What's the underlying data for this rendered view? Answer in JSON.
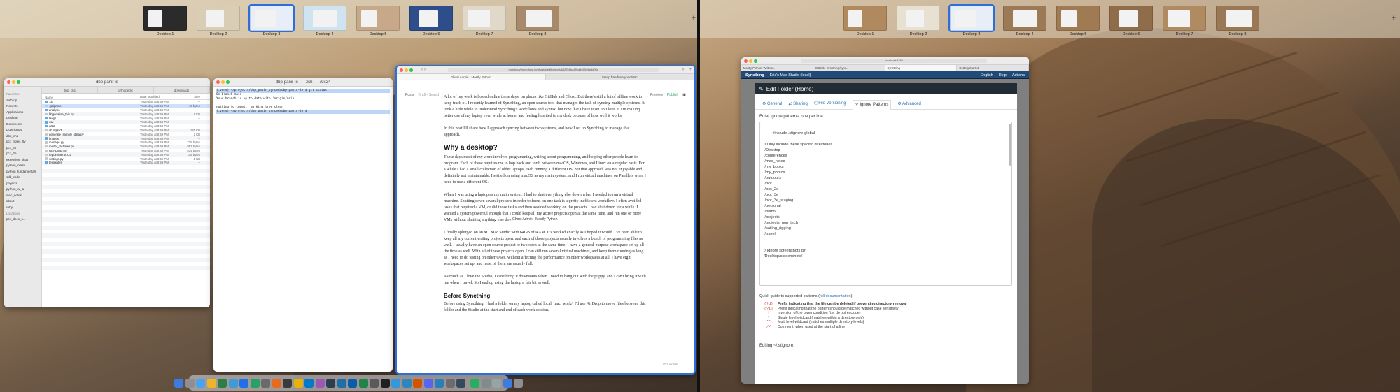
{
  "desktops_left": [
    "Desktop 1",
    "Desktop 2",
    "Desktop 3",
    "Desktop 4",
    "Desktop 5",
    "Desktop 6",
    "Desktop 7",
    "Desktop 8"
  ],
  "desktops_right": [
    "Desktop 1",
    "Desktop 2",
    "Desktop 3",
    "Desktop 4",
    "Desktop 5",
    "Desktop 6",
    "Desktop 7",
    "Desktop 8"
  ],
  "colors": {
    "accent": "#2c6fdc",
    "syncthing_nav": "#204b78",
    "published": "#29a35a"
  },
  "finder": {
    "title": "dbp-panir-ie",
    "sidebar_favorites": "Favorites",
    "sidebar": [
      "AirDrop",
      "Recents",
      "Applications",
      "Desktop",
      "Documents",
      "Downloads",
      "dbp_ch1",
      "pcc_notes_ltv",
      "pcc_sp",
      "pcc_2e",
      "extension_pkgs",
      "python_crash",
      "python_fundamentals",
      "sdd_code",
      "projects",
      "python_w_ia",
      "mac_notes",
      "about",
      "retry"
    ],
    "sidebar_locations": "Locations",
    "sidebar_locations_item": "pcc_docs_s...",
    "tabs": [
      "dbp_ch1",
      "orthopedic",
      "downloads"
    ],
    "headers": [
      "Name",
      "Date Modified",
      "Size"
    ],
    "rows": [
      {
        "name": ".git",
        "date": "Yesterday at 8:59 PM",
        "size": "--",
        "folder": true
      },
      {
        "name": ".gitignore",
        "date": "Yesterday at 8:59 PM",
        "size": "40 bytes",
        "folder": false
      },
      {
        "name": "analysis",
        "date": "Yesterday at 8:59 PM",
        "size": "--",
        "folder": true
      },
      {
        "name": "bbgenalise_this.py",
        "date": "Yesterday at 8:59 PM",
        "size": "1 KB",
        "folder": false
      },
      {
        "name": "blogs",
        "date": "Yesterday at 8:59 PM",
        "size": "--",
        "folder": true
      },
      {
        "name": "csv",
        "date": "Yesterday at 8:59 PM",
        "size": "--",
        "folder": true
      },
      {
        "name": "data",
        "date": "Yesterday at 8:59 PM",
        "size": "--",
        "folder": true
      },
      {
        "name": "db.sqlite3",
        "date": "Yesterday at 8:59 PM",
        "size": "131 KB",
        "folder": false
      },
      {
        "name": "generate_sample_data.py",
        "date": "Yesterday at 8:59 PM",
        "size": "2 KB",
        "folder": false
      },
      {
        "name": "images",
        "date": "Yesterday at 8:59 PM",
        "size": "--",
        "folder": true
      },
      {
        "name": "manage.py",
        "date": "Yesterday at 8:59 PM",
        "size": "715 bytes",
        "folder": false
      },
      {
        "name": "model_factories.py",
        "date": "Yesterday at 8:59 PM",
        "size": "952 bytes",
        "folder": false
      },
      {
        "name": "README.md",
        "date": "Yesterday at 8:59 PM",
        "size": "834 bytes",
        "folder": false
      },
      {
        "name": "requirements.txt",
        "date": "Yesterday at 8:59 PM",
        "size": "119 bytes",
        "folder": false
      },
      {
        "name": "settings.py",
        "date": "Yesterday at 8:59 PM",
        "size": "1 KB",
        "folder": false
      },
      {
        "name": "templates",
        "date": "Yesterday at 8:59 PM",
        "size": "--",
        "folder": true
      }
    ]
  },
  "terminal": {
    "title": "dbp-panir-ie — -zsh — 79x24",
    "lines": [
      "(.venv) ~/projects/dbp_panir_synced/dbp-panir-ie $ git status",
      "On branch main",
      "Your branch is up to date with 'origin/main'.",
      "",
      "nothing to commit, working tree clean",
      "(.venv) ~/projects/dbp_panir_synced/dbp-panir-ie $"
    ]
  },
  "safari_left": {
    "url": "mostly-python.ghost.io/ghost/#/editor/post/6427b5ba49ea460001a8d09a",
    "tabs": [
      "Ghost Admin - Mostly Python",
      "Setup free from your Mac"
    ],
    "editor": {
      "posts": "Posts",
      "status": "Draft - Saved",
      "preview": "Preview",
      "publish": "Publish"
    },
    "tooltip": "Ghost Admin - Mostly Python",
    "word_count": "877 words",
    "p1": "A lot of my work is hosted online these days, on places like GitHub and Ghost. But there's still a lot of offline work to keep track of. I recently learned of Syncthing, an open source tool that manages the task of syncing multiple systems. It took a little while to understand Syncthing's workflows and syntax, but now that I have it set up I love it. I'm making better use of my laptop even while at home, and feeling less tied to my desk because of how well it works.",
    "p2": "In this post I'll share how I approach syncing between two systems, and how I set up Syncthing to manage that approach.",
    "h_desktop": "Why a desktop?",
    "p3": "These days most of my work involves programming, writing about programming, and helping other people learn to program. Each of these requires me to hop back and forth between macOS, Windows, and Linux on a regular basis. For a while I had a small collection of older laptops, each running a different OS, but that approach was not enjoyable and definitely not maintainable. I settled on using macOS as my main system, and I run virtual machines on Parallels when I need to use a different OS.",
    "p4": "When I was using a laptop as my main system, I had to shut everything else down when I needed to run a virtual machine. Shutting down several projects in order to focus on one task is a pretty inefficient workflow. I often avoided tasks that required a VM, or did those tasks and then avoided working on the projects I had shut down for a while. I wanted a system powerful enough that I could keep all my active projects open at the same time, and run one or more VMs without shutting anything else down.",
    "p5": "I finally splurged on an M1 Mac Studio with 64GB of RAM. It's worked exactly as I hoped it would. I've been able to keep all my current writing projects open, and each of those projects usually involves a bunch of programming files as well. I usually have an open source project or two open at the same time. I have a general-purpose workspace set up all the time as well. With all of these projects open, I can still run several virtual machines, and keep them running as long as I need to do testing on other OSes, without affecting the performance on other workspaces at all. I have eight workspaces set up, and most of them are usually full.",
    "p6": "As much as I love the Studio, I can't bring it downstairs when I need to hang out with the puppy, and I can't bring it with me when I travel. So I end up using the laptop a fair bit as well.",
    "h_before": "Before Syncthing",
    "p7": "Before using Syncthing, I had a folder on my laptop called local_mac_work/. I'd use AirDrop to move files between this folder and the Studio at the start and end of each work session."
  },
  "safari_right": {
    "url": "localhost:8384",
    "tabs": [
      "Mostly Python: Writers...",
      "GitHub - syncthing/sync...",
      "Syncthing",
      "Getting Started"
    ],
    "nav": {
      "logo": "Syncthing",
      "device": "Eric's Mac Studio (local)",
      "language": "English",
      "help": "Help",
      "actions": "Actions"
    },
    "modal": {
      "title": "Edit Folder (Home)",
      "tabs": [
        "General",
        "Sharing",
        "File Versioning",
        "Ignore Patterns",
        "Advanced"
      ],
      "active_tab": 3,
      "intro": "Enter ignore patterns, one per line.",
      "patterns": "#include .stignore-global\n\n// Only include these specific directories.\n!/Desktop\n!/conferences\n!/mac_notes\n!/my_books\n!/my_photos\n!/outdoors\n!/pcc\n!/pcc_2e\n!/pcc_3e\n!/pcc_3e_staging\n!/personal\n!/piano\n!/projects\n!/projects_non_tech\n!/sailing_rigging\n!/travel\n\n\n// Ignore screenshots dir.\n/Desktop/screenshots/",
      "quick_guide": "Quick guide to supported patterns (",
      "full_docs": "full documentation",
      "quick_guide_end": "):",
      "guide": [
        {
          "k": "(?d)",
          "v": "Prefix indicating that the file can be deleted if preventing directory removal",
          "bold": true
        },
        {
          "k": "(?i)",
          "v": "Prefix indicating that the pattern should be matched without case sensitivity",
          "bold": false
        },
        {
          "k": "!",
          "v": "Inversion of the given condition (i.e. do not exclude)",
          "bold": false
        },
        {
          "k": "*",
          "v": "Single level wildcard (matches within a directory only)",
          "bold": false
        },
        {
          "k": "**",
          "v": "Multi level wildcard (matches multiple directory levels)",
          "bold": false
        },
        {
          "k": "//",
          "v": "Comment, when used at the start of a line",
          "bold": false
        }
      ],
      "editing": "Editing ~/.stignore."
    }
  }
}
